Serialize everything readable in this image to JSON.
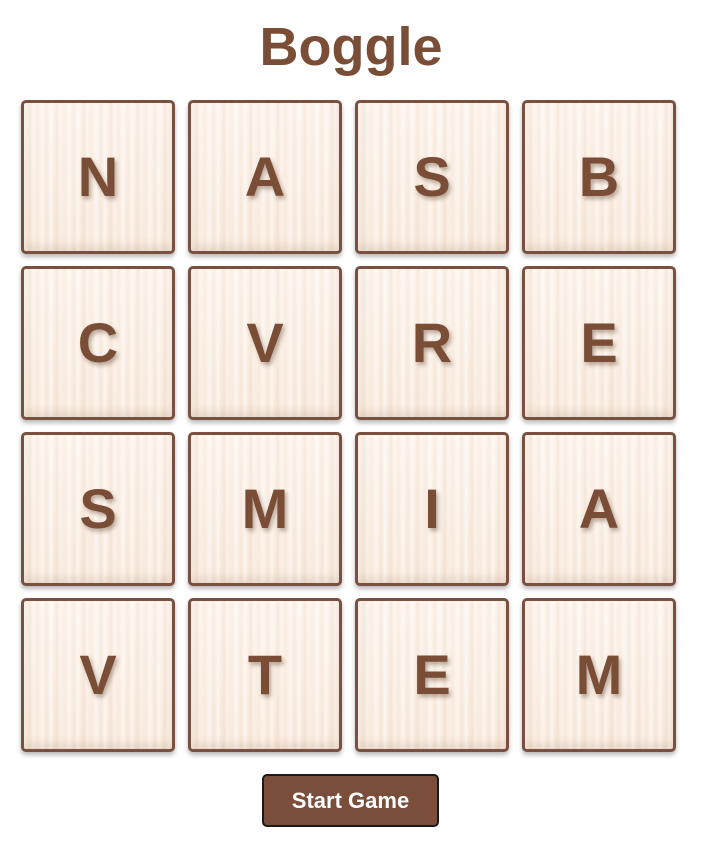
{
  "title": "Boggle",
  "board": {
    "rows": [
      [
        "N",
        "A",
        "S",
        "B"
      ],
      [
        "C",
        "V",
        "R",
        "E"
      ],
      [
        "S",
        "M",
        "I",
        "A"
      ],
      [
        "V",
        "T",
        "E",
        "M"
      ]
    ]
  },
  "controls": {
    "start_label": "Start Game"
  },
  "colors": {
    "accent": "#7a4e36",
    "tile_background": "#fbeee2",
    "tile_border": "#7a5140",
    "button_background": "#7a4e3a",
    "button_text": "#ffffff"
  }
}
